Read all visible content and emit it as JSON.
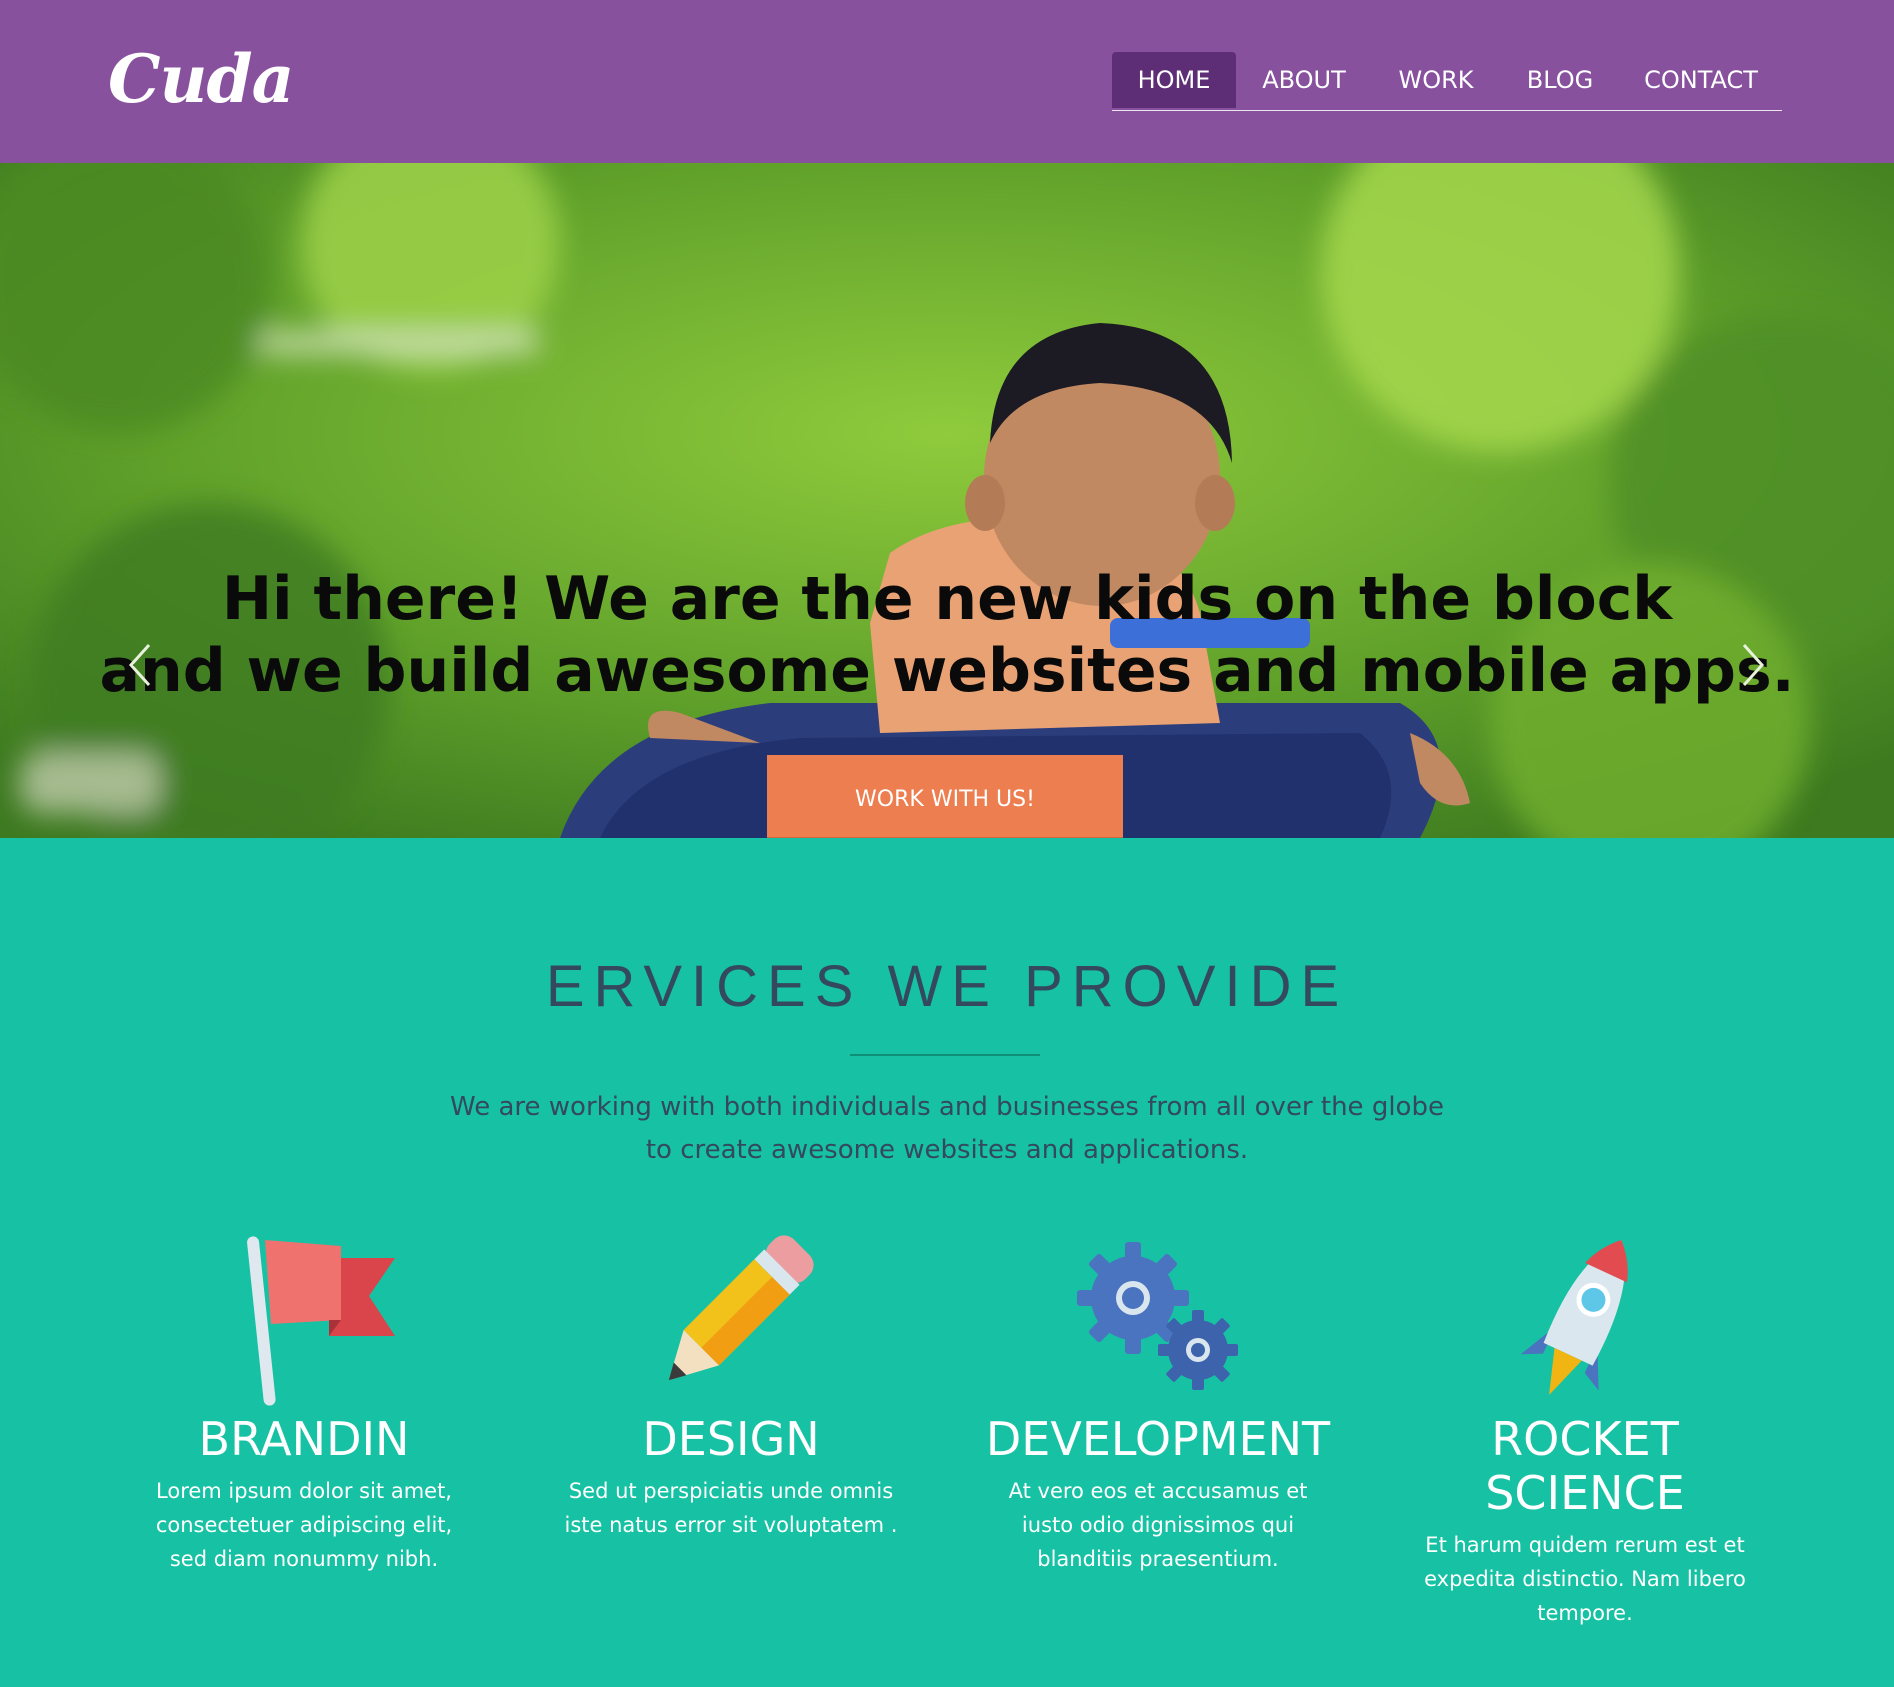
{
  "brand": {
    "logo_text": "Cuda"
  },
  "nav": {
    "items": [
      {
        "label": "HOME",
        "active": true
      },
      {
        "label": "ABOUT",
        "active": false
      },
      {
        "label": "WORK",
        "active": false
      },
      {
        "label": "BLOG",
        "active": false
      },
      {
        "label": "CONTACT",
        "active": false
      }
    ]
  },
  "hero": {
    "title_line1": "Hi there! We are the new kids on the block",
    "title_line2": "and we build awesome websites and mobile apps.",
    "cta_label": "WORK WITH US!",
    "slides_total": 4,
    "active_slide": 1
  },
  "services": {
    "title": "ERVICES WE PROVIDE",
    "subtitle_line1": "We are working with both individuals and businesses from all over the globe",
    "subtitle_line2": "to create awesome websites and applications.",
    "items": [
      {
        "icon": "flag-icon",
        "title": "BRANDIN",
        "text": "Lorem ipsum dolor sit amet, consectetuer adipiscing elit, sed diam nonummy nibh."
      },
      {
        "icon": "pencil-icon",
        "title": "DESIGN",
        "text": "Sed ut perspiciatis unde omnis iste natus error sit voluptatem ."
      },
      {
        "icon": "gears-icon",
        "title": "DEVELOPMENT",
        "text": "At vero eos et accusamus et iusto odio dignissimos qui blanditiis praesentium."
      },
      {
        "icon": "rocket-icon",
        "title": "ROCKET SCIENCE",
        "text": "Et harum quidem rerum est et expedita distinctio. Nam libero tempore."
      }
    ]
  },
  "colors": {
    "header_bg": "#87519e",
    "nav_active_bg": "#5d2e75",
    "cta_bg": "#ec7e50",
    "services_bg": "#16c2a3",
    "heading_text": "#34495e"
  }
}
